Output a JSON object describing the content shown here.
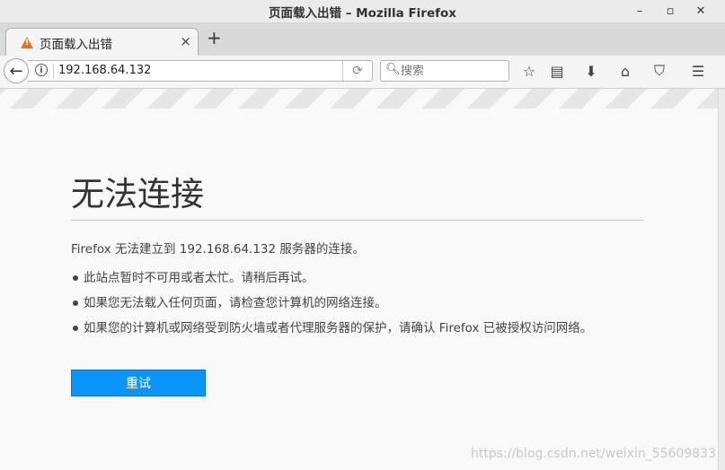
{
  "window": {
    "title": "页面载入出错 – Mozilla Firefox",
    "minimize_glyph": "–",
    "maximize_glyph": "▫",
    "close_glyph": "✕"
  },
  "tab": {
    "title": "页面载入出错",
    "close_glyph": "×",
    "icon": "warning-icon"
  },
  "new_tab_glyph": "+",
  "navbar": {
    "url": "192.168.64.132",
    "search_placeholder": "搜索",
    "icons": [
      "back-icon",
      "info-icon",
      "reload-icon",
      "search-icon",
      "bookmark-star-icon",
      "reader-list-icon",
      "download-icon",
      "home-icon",
      "pocket-icon",
      "menu-icon"
    ]
  },
  "error": {
    "title": "无法连接",
    "message": "Firefox 无法建立到 192.168.64.132 服务器的连接。",
    "bullets": [
      "此站点暂时不可用或者太忙。请稍后再试。",
      "如果您无法载入任何页面，请检查您计算机的网络连接。",
      "如果您的计算机或网络受到防火墙或者代理服务器的保护，请确认 Firefox 已被授权访问网络。"
    ],
    "retry_label": "重试"
  },
  "watermark": "https://blog.csdn.net/weixin_55609833",
  "colors": {
    "accent": "#0996f8",
    "warning": "#e8731a",
    "background": "#f9f9fa"
  }
}
